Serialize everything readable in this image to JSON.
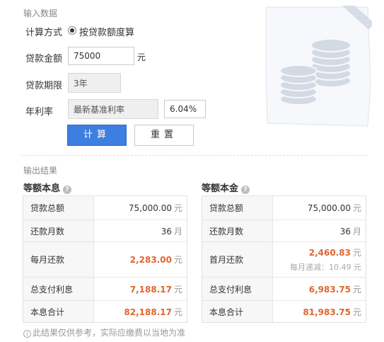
{
  "input_section": {
    "title": "输入数据",
    "calc_method_label": "计算方式",
    "calc_method_option": "按贷款额度算",
    "loan_amount_label": "贷款金额",
    "loan_amount_value": "75000",
    "loan_amount_unit": "元",
    "loan_term_label": "贷款期限",
    "loan_term_value": "3年",
    "rate_label": "年利率",
    "rate_type_value": "最新基准利率",
    "rate_value": "6.04%",
    "calculate_button": "计算",
    "reset_button": "重置"
  },
  "output_section": {
    "title": "输出结果",
    "equal_installment": {
      "title": "等额本息",
      "rows": [
        {
          "label": "贷款总额",
          "value": "75,000.00",
          "unit": "元",
          "highlight": false
        },
        {
          "label": "还款月数",
          "value": "36",
          "unit": "月",
          "highlight": false
        },
        {
          "label": "每月还款",
          "value": "2,283.00",
          "unit": "元",
          "highlight": true
        },
        {
          "label": "总支付利息",
          "value": "7,188.17",
          "unit": "元",
          "highlight": true
        },
        {
          "label": "本息合计",
          "value": "82,188.17",
          "unit": "元",
          "highlight": true
        }
      ]
    },
    "equal_principal": {
      "title": "等额本金",
      "rows": [
        {
          "label": "贷款总额",
          "value": "75,000.00",
          "unit": "元",
          "highlight": false
        },
        {
          "label": "还款月数",
          "value": "36",
          "unit": "月",
          "highlight": false
        },
        {
          "label": "首月还款",
          "value": "2,460.83",
          "unit": "元",
          "highlight": true,
          "sub": "每月递减：10.49 元"
        },
        {
          "label": "总支付利息",
          "value": "6,983.75",
          "unit": "元",
          "highlight": true
        },
        {
          "label": "本息合计",
          "value": "81,983.75",
          "unit": "元",
          "highlight": true
        }
      ]
    },
    "note": "此结果仅供参考，实际应缴费以当地为准"
  },
  "colors": {
    "primary_button": "#3d7fe0",
    "highlight_value": "#e0652d",
    "illustration": "#cdd5e1"
  },
  "icons": {
    "help": "help-icon",
    "info": "info-icon",
    "illustration": "coins-illustration"
  }
}
